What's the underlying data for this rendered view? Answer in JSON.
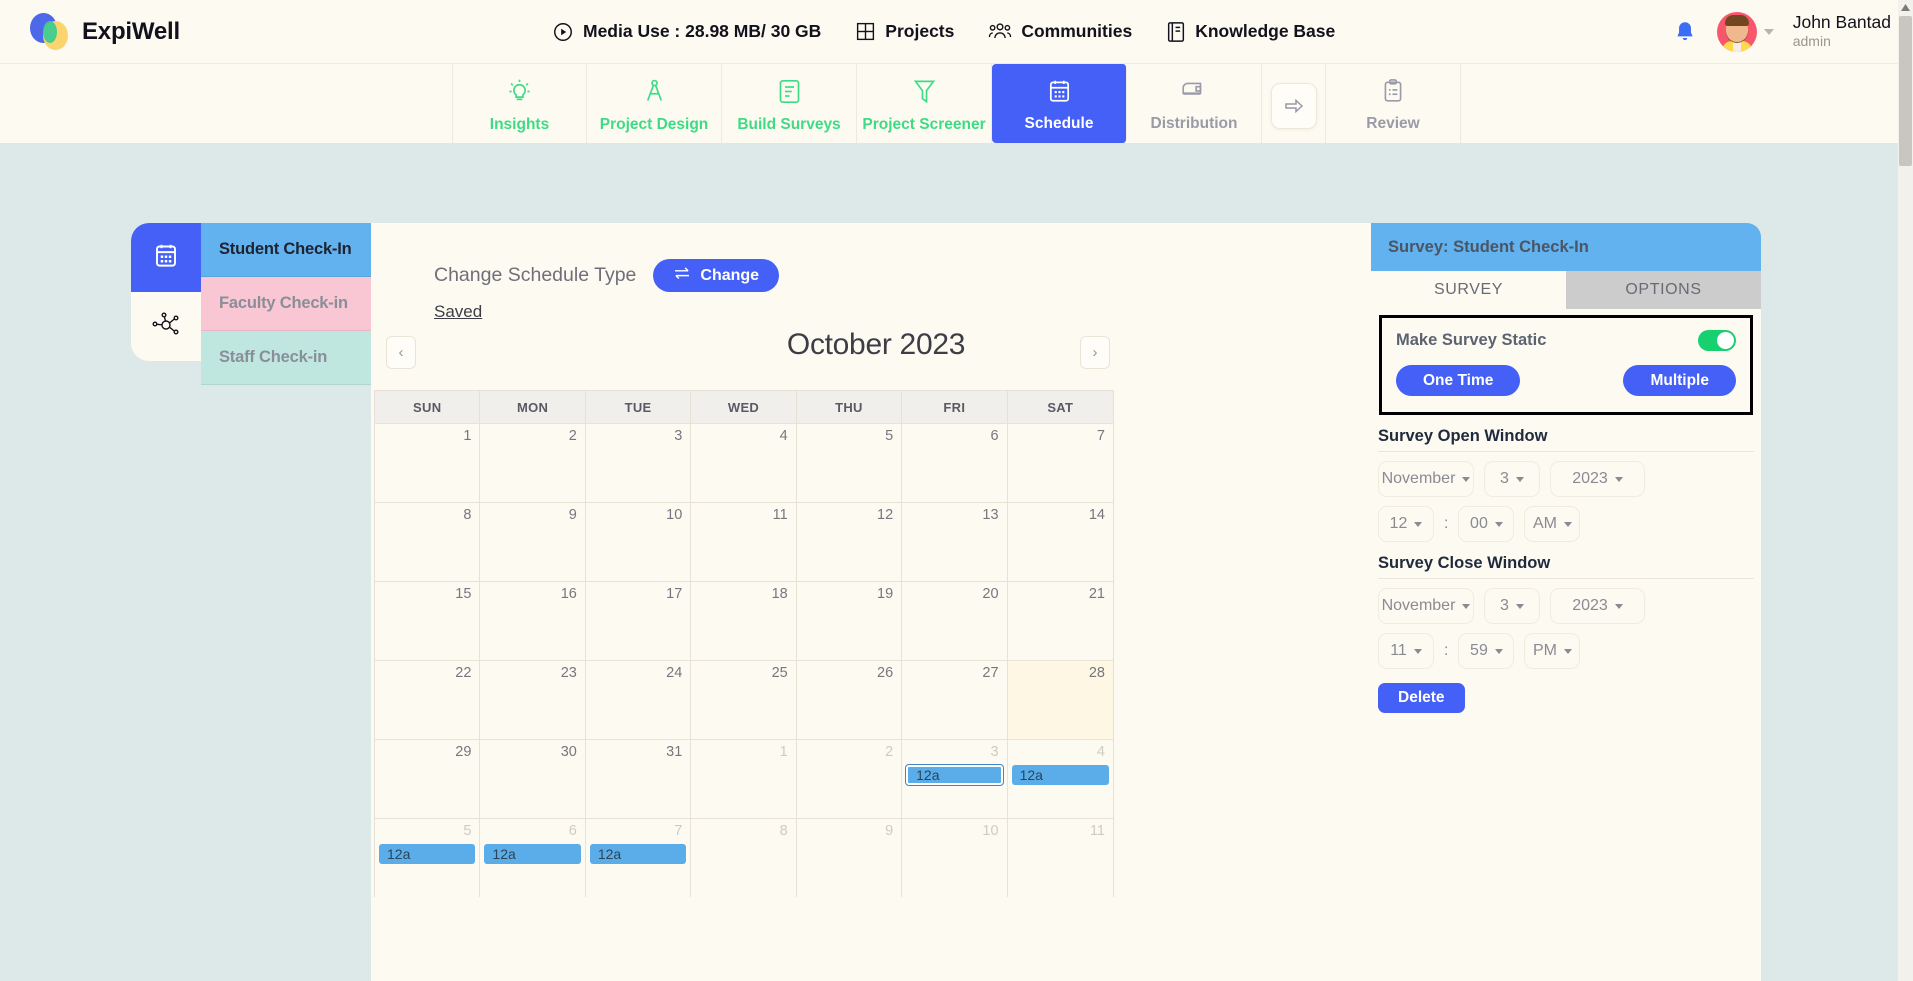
{
  "brand": {
    "name": "ExpiWell"
  },
  "header": {
    "media_use": "Media Use : 28.98 MB/ 30 GB",
    "nav": [
      {
        "label": "Projects",
        "icon": "grid-icon"
      },
      {
        "label": "Communities",
        "icon": "people-icon"
      },
      {
        "label": "Knowledge Base",
        "icon": "book-icon"
      }
    ],
    "user": {
      "name": "John Bantad",
      "role": "admin"
    }
  },
  "subnav": {
    "items": [
      {
        "label": "Insights",
        "icon": "lightbulb-icon",
        "active": false
      },
      {
        "label": "Project Design",
        "icon": "compass-icon",
        "active": false
      },
      {
        "label": "Build Surveys",
        "icon": "document-icon",
        "active": false
      },
      {
        "label": "Project Screener",
        "icon": "funnel-icon",
        "active": false
      },
      {
        "label": "Schedule",
        "icon": "calendar-icon",
        "active": true
      },
      {
        "label": "Distribution",
        "icon": "mailbox-icon",
        "active": false
      },
      {
        "label": "Review",
        "icon": "clipboard-icon",
        "active": false
      }
    ],
    "arrow_icon": "arrow-right-icon"
  },
  "sidebar": {
    "rail": [
      {
        "icon": "calendar-icon",
        "active": true
      },
      {
        "icon": "network-icon",
        "active": false
      }
    ],
    "surveys": [
      {
        "label": "Student Check-In",
        "state": "selected"
      },
      {
        "label": "Faculty Check-in",
        "state": "pink"
      },
      {
        "label": "Staff Check-in",
        "state": "teal"
      }
    ]
  },
  "calendar": {
    "change_schedule_label": "Change Schedule Type",
    "change_button": "Change",
    "saved_link": "Saved",
    "prev_label": "‹",
    "next_label": "›",
    "title": "October 2023",
    "dow": [
      "SUN",
      "MON",
      "TUE",
      "WED",
      "THU",
      "FRI",
      "SAT"
    ],
    "weeks": [
      [
        {
          "n": "1",
          "other": false
        },
        {
          "n": "2",
          "other": false
        },
        {
          "n": "3",
          "other": false
        },
        {
          "n": "4",
          "other": false
        },
        {
          "n": "5",
          "other": false
        },
        {
          "n": "6",
          "other": false
        },
        {
          "n": "7",
          "other": false
        }
      ],
      [
        {
          "n": "8",
          "other": false
        },
        {
          "n": "9",
          "other": false
        },
        {
          "n": "10",
          "other": false
        },
        {
          "n": "11",
          "other": false
        },
        {
          "n": "12",
          "other": false
        },
        {
          "n": "13",
          "other": false
        },
        {
          "n": "14",
          "other": false
        }
      ],
      [
        {
          "n": "15",
          "other": false
        },
        {
          "n": "16",
          "other": false
        },
        {
          "n": "17",
          "other": false
        },
        {
          "n": "18",
          "other": false
        },
        {
          "n": "19",
          "other": false
        },
        {
          "n": "20",
          "other": false
        },
        {
          "n": "21",
          "other": false
        }
      ],
      [
        {
          "n": "22",
          "other": false
        },
        {
          "n": "23",
          "other": false
        },
        {
          "n": "24",
          "other": false
        },
        {
          "n": "25",
          "other": false
        },
        {
          "n": "26",
          "other": false
        },
        {
          "n": "27",
          "other": false
        },
        {
          "n": "28",
          "other": false,
          "today": true
        }
      ],
      [
        {
          "n": "29",
          "other": false
        },
        {
          "n": "30",
          "other": false
        },
        {
          "n": "31",
          "other": false
        },
        {
          "n": "1",
          "other": true
        },
        {
          "n": "2",
          "other": true
        },
        {
          "n": "3",
          "other": true,
          "event": "12a",
          "selected": true
        },
        {
          "n": "4",
          "other": true,
          "event": "12a"
        }
      ],
      [
        {
          "n": "5",
          "other": true,
          "event": "12a"
        },
        {
          "n": "6",
          "other": true,
          "event": "12a"
        },
        {
          "n": "7",
          "other": true,
          "event": "12a"
        },
        {
          "n": "8",
          "other": true
        },
        {
          "n": "9",
          "other": true
        },
        {
          "n": "10",
          "other": true
        },
        {
          "n": "11",
          "other": true
        }
      ]
    ]
  },
  "right_panel": {
    "title": "Survey: Student Check-In",
    "tabs": [
      {
        "label": "SURVEY",
        "active": true
      },
      {
        "label": "OPTIONS",
        "active": false
      }
    ],
    "static": {
      "label": "Make Survey Static",
      "toggle_on": true,
      "one_time": "One Time",
      "multiple": "Multiple"
    },
    "open_window": {
      "title": "Survey Open Window",
      "month": "November",
      "day": "3",
      "year": "2023",
      "hour": "12",
      "minute": "00",
      "ampm": "AM",
      "colon": ":"
    },
    "close_window": {
      "title": "Survey Close Window",
      "month": "November",
      "day": "3",
      "year": "2023",
      "hour": "11",
      "minute": "59",
      "ampm": "PM",
      "colon": ":"
    },
    "delete_button": "Delete"
  },
  "colors": {
    "accent_blue": "#4460f7",
    "nav_green": "#3ddc84",
    "survey_blue": "#62b2ef",
    "survey_pink": "#f9c6d3",
    "survey_teal": "#bfe7e0",
    "toggle_green": "#17d070",
    "page_bg": "#dde9e8",
    "panel_bg": "#fdfaf1"
  }
}
